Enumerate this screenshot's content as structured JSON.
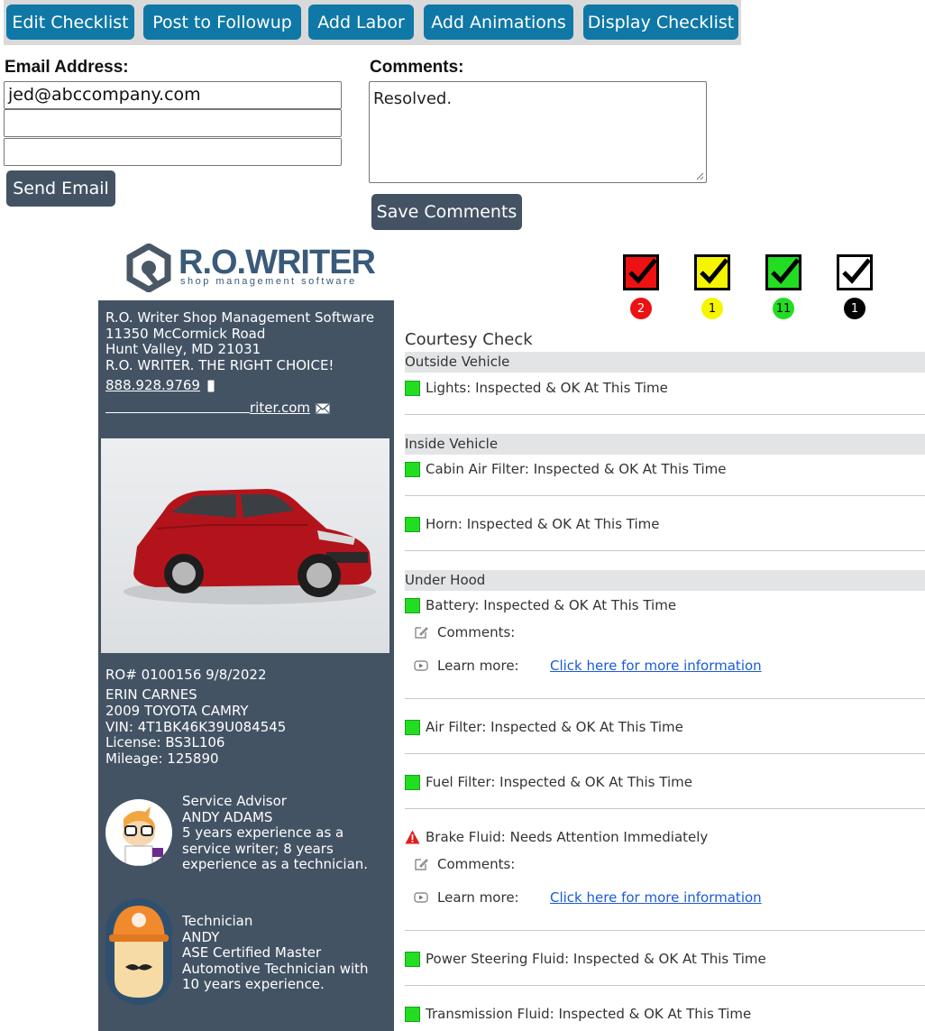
{
  "toolbar": {
    "buttons": [
      "Edit Checklist",
      "Post to Followup",
      "Add Labor",
      "Add Animations",
      "Display Checklist"
    ]
  },
  "email": {
    "label": "Email Address:",
    "fields": [
      "jed@abccompany.com",
      "",
      ""
    ],
    "send_label": "Send Email"
  },
  "comments": {
    "label": "Comments:",
    "value": "Resolved.",
    "save_label": "Save Comments"
  },
  "logo": {
    "name": "R.O.WRITER",
    "tagline": "shop management software"
  },
  "shop": {
    "name": "R.O. Writer Shop Management Software",
    "address1": "11350 McCormick Road",
    "address2": "Hunt Valley, MD 21031",
    "slogan": "R.O. WRITER. THE RIGHT CHOICE!",
    "phone": "888.928.9769",
    "email_suffix": "riter.com"
  },
  "vehicle": {
    "ro_line": "RO# 0100156   9/8/2022",
    "customer": "ERIN CARNES",
    "model": "2009 TOYOTA CAMRY",
    "vin": "VIN: 4T1BK46K39U084545",
    "license": "License: BS3L106",
    "mileage": "Mileage: 125890"
  },
  "advisor": {
    "role": "Service Advisor",
    "name": "ANDY ADAMS",
    "bio": "5 years experience as a service writer; 8 years experience as a technician."
  },
  "technician": {
    "role": "Technician",
    "name": "ANDY",
    "bio": "ASE Certified Master Automotive Technician with 10 years experience."
  },
  "summary": {
    "red": "2",
    "yellow": "1",
    "green": "11",
    "black": "1",
    "colors": {
      "red": "#ee1111",
      "yellow": "#f5f500",
      "green": "#22dd22",
      "black": "#000000"
    }
  },
  "checklist": {
    "title": "Courtesy Check",
    "categories": {
      "outside": "Outside Vehicle",
      "inside": "Inside Vehicle",
      "under_hood": "Under Hood"
    },
    "items": {
      "lights": "Lights:  Inspected & OK At This Time",
      "cabin_air_filter": "Cabin Air Filter:  Inspected & OK At This Time",
      "horn": "Horn:  Inspected & OK At This Time",
      "battery": "Battery:  Inspected & OK At This Time",
      "air_filter": "Air Filter:  Inspected & OK At This Time",
      "fuel_filter": "Fuel Filter:  Inspected & OK At This Time",
      "brake_fluid": "Brake Fluid:  Needs Attention Immediately",
      "power_steering": "Power Steering Fluid:  Inspected & OK At This Time",
      "transmission": "Transmission Fluid:  Inspected & OK At This Time"
    },
    "comments_label": "Comments:",
    "learn_more_label": "Learn more:",
    "learn_more_link": "Click here for more information"
  }
}
